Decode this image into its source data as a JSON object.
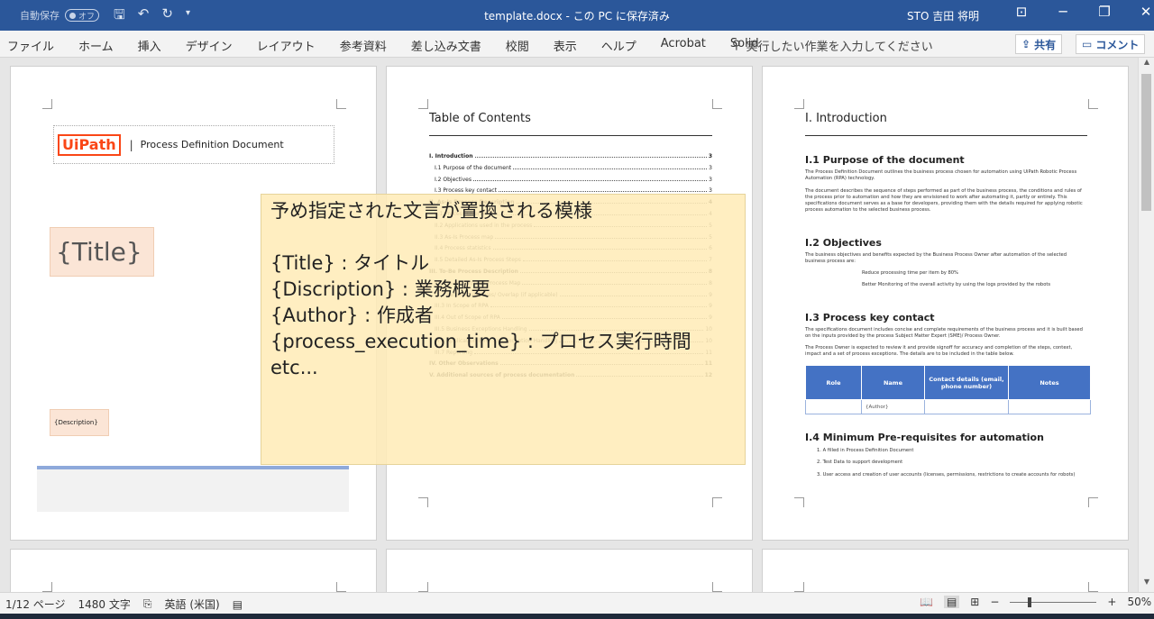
{
  "titlebar": {
    "autosave_label": "自動保存",
    "autosave_state": "オフ",
    "doc_title": "template.docx - この PC に保存済み",
    "user": "STO 吉田 将明"
  },
  "ribbon": {
    "tabs": [
      "ファイル",
      "ホーム",
      "挿入",
      "デザイン",
      "レイアウト",
      "参考資料",
      "差し込み文書",
      "校閲",
      "表示",
      "ヘルプ",
      "Acrobat",
      "Solid"
    ],
    "tellme": "実行したい作業を入力してください",
    "share": "共有",
    "comment": "コメント"
  },
  "page1": {
    "logo": "UiPath",
    "separator": "|",
    "header_text": "Process Definition Document",
    "title_placeholder": "{Title}",
    "desc_placeholder": "{Description}"
  },
  "page2": {
    "toc_title": "Table of Contents",
    "entries": [
      {
        "text": "I. Introduction",
        "page": "3",
        "bold": true
      },
      {
        "text": "I.1 Purpose of the document",
        "page": "3"
      },
      {
        "text": "I.2 Objectives",
        "page": "3"
      },
      {
        "text": "I.3 Process key contact",
        "page": "3"
      },
      {
        "text": "II. As-Is Process Description",
        "page": "4",
        "bold": true
      },
      {
        "text": "II.1 Process Overview",
        "page": "4"
      },
      {
        "text": "II.2 Applications used in the process",
        "page": "5"
      },
      {
        "text": "II.3 As-Is Process map",
        "page": "5"
      },
      {
        "text": "II.4 Process statistics",
        "page": "6"
      },
      {
        "text": "II.5 Detailed As-Is Process Steps",
        "page": "7"
      },
      {
        "text": "III. To-Be Process Description",
        "page": "8",
        "bold": true
      },
      {
        "text": "III.1 To-Be Detailed Process Map",
        "page": "8"
      },
      {
        "text": "III.2 Parallel Initiatives/ Overlap (if applicable)",
        "page": "9"
      },
      {
        "text": "III.3 In Scope of RPA",
        "page": "9"
      },
      {
        "text": "III.4 Out of Scope of RPA",
        "page": "9"
      },
      {
        "text": "III.5 Business Exceptions Handling",
        "page": "10"
      },
      {
        "text": "III.6 Application Error and Exception Handling",
        "page": "10"
      },
      {
        "text": "III.7 Reporting",
        "page": "11"
      },
      {
        "text": "IV. Other Observations",
        "page": "11",
        "bold": true
      },
      {
        "text": "V. Additional sources of process documentation",
        "page": "12",
        "bold": true
      }
    ]
  },
  "page3": {
    "h1": "I. Introduction",
    "s1": "I.1 Purpose of the document",
    "s1_p1": "The Process Definition Document outlines the business process chosen for automation using UiPath Robotic Process Automation (RPA) technology.",
    "s1_p2": "The document describes the sequence of steps performed as part of the business process, the conditions and rules of the process prior to automation and how they are envisioned to work after automating it, partly or entirely. This specifications document serves as a base for developers, providing them with the details required for applying robotic process automation to the selected business process.",
    "s2": "I.2 Objectives",
    "s2_p1": "The business objectives and benefits expected by the Business Process Owner after automation of the selected business process are:",
    "s2_b1": "Reduce processing time per item by 80%",
    "s2_b2": "Better Monitoring of the overall activity by using the logs provided by the robots",
    "s3": "I.3 Process key contact",
    "s3_p1": "The specifications document includes concise and complete requirements of the business process and it is built based on the inputs provided by the process Subject Matter Expert (SME)/ Process Owner.",
    "s3_p2": "The Process Owner is expected to review it and provide signoff for accuracy and completion of the steps, context, impact and a set of process exceptions. The details are to be included in the table below.",
    "table_headers": [
      "Role",
      "Name",
      "Contact details (email, phone number)",
      "Notes"
    ],
    "table_row": [
      "",
      "{Author}",
      "",
      ""
    ],
    "s4": "I.4 Minimum Pre-requisites for automation",
    "s4_items": [
      "1. A filled in Process Definition Document",
      "2. Test Data to support development",
      "3. User access and creation of user accounts (licenses, permissions, restrictions to create accounts for robots)"
    ]
  },
  "overlay": {
    "heading": "予め指定された文言が置換される模様",
    "lines": [
      "{Title} : タイトル",
      "{Discription} : 業務概要",
      "{Author} : 作成者",
      "{process_execution_time} : プロセス実行時間",
      "etc..."
    ]
  },
  "statusbar": {
    "page": "1/12 ページ",
    "words": "1480 文字",
    "language": "英語 (米国)",
    "zoom": "50%",
    "zoom_minus": "−",
    "zoom_plus": "+"
  }
}
